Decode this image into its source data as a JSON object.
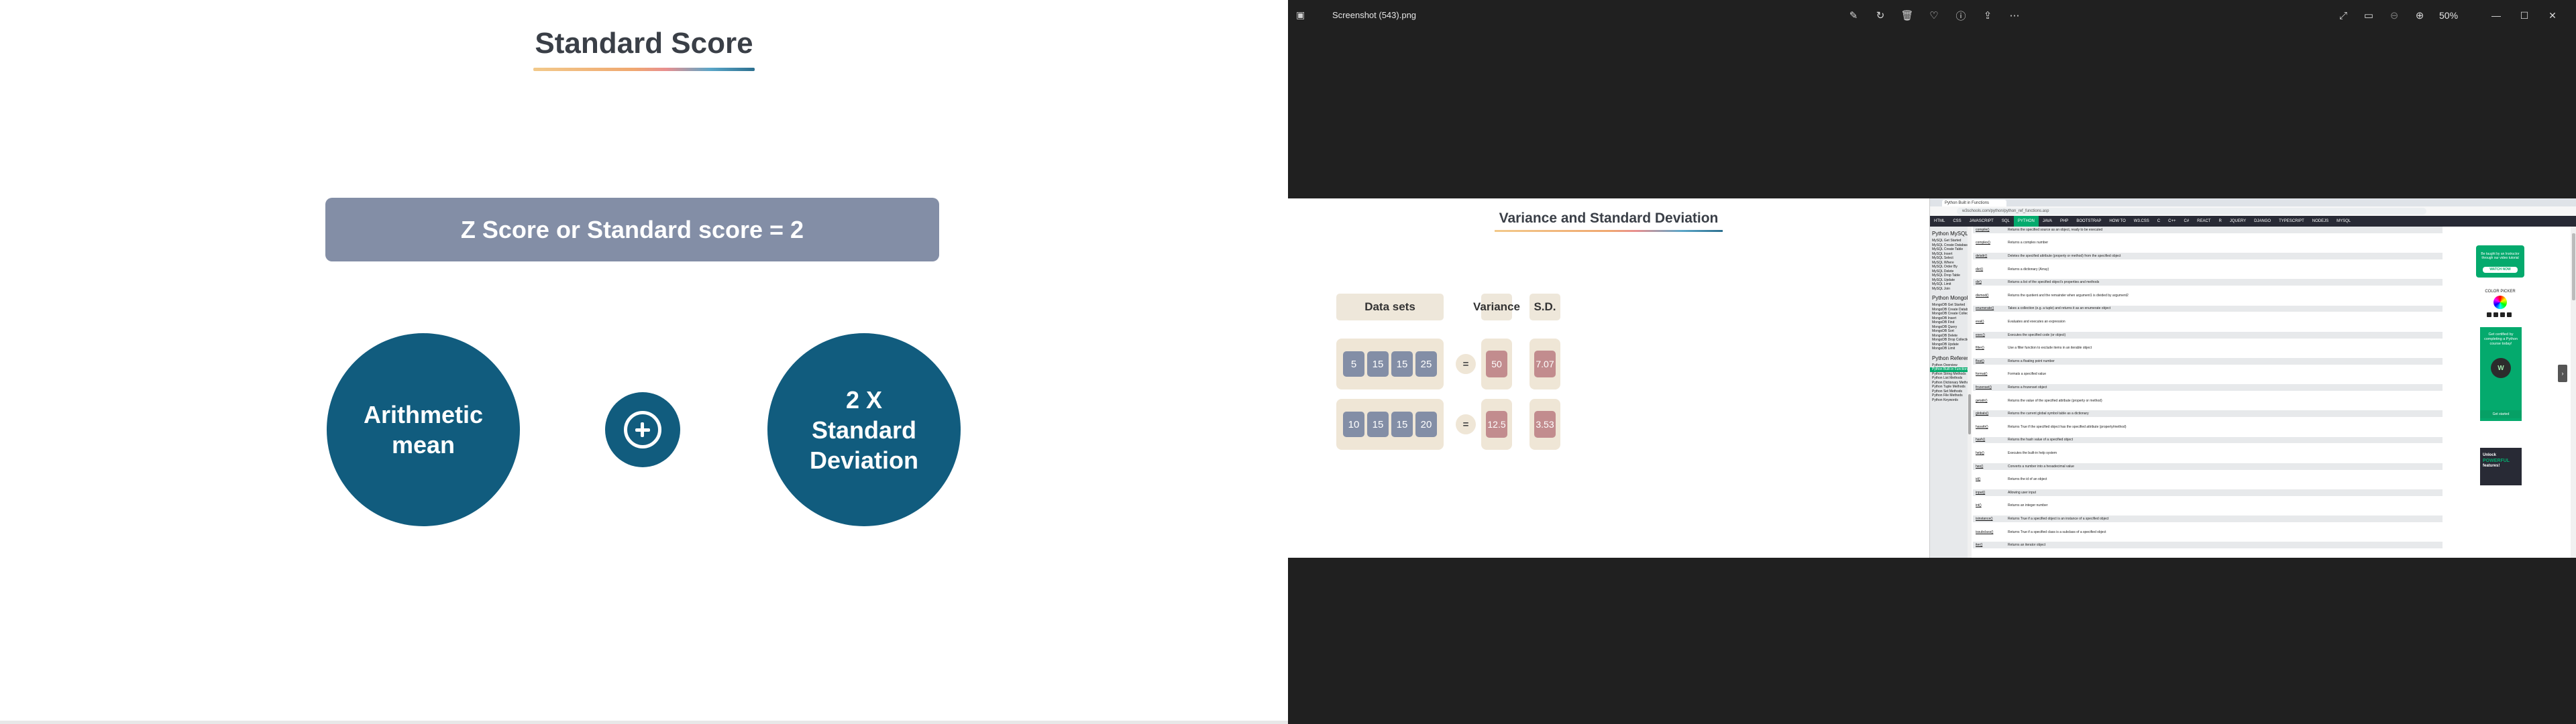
{
  "slide": {
    "title": "Standard Score",
    "z_bar": "Z Score or Standard score = 2",
    "circle_left": "Arithmetic mean",
    "circle_right": "2 X Standard Deviation"
  },
  "viewer": {
    "file_title": "Screenshot (543).png",
    "zoom": "50%",
    "toolbar_icons": [
      "edit-icon",
      "rotate-icon",
      "delete-icon",
      "favorite-icon",
      "info-icon",
      "share-icon",
      "more-icon"
    ],
    "window_icons": [
      "expand-icon",
      "fit-icon",
      "zoom-out-icon",
      "zoom-in-icon",
      "minimize-icon",
      "maximize-icon",
      "close-icon"
    ]
  },
  "inner_slide": {
    "title": "Variance and Standard Deviation",
    "headers": {
      "datasets": "Data sets",
      "variance": "Variance",
      "sd": "S.D."
    },
    "rows": [
      {
        "values": [
          "5",
          "15",
          "15",
          "25"
        ],
        "eq": "=",
        "variance": "50",
        "sd": "7.07"
      },
      {
        "values": [
          "10",
          "15",
          "15",
          "20"
        ],
        "eq": "=",
        "variance": "12.5",
        "sd": "3.53"
      }
    ]
  },
  "browser": {
    "tab_label": "Python Built in Functions",
    "url": "w3schools.com/python/python_ref_functions.asp",
    "nav": [
      "HTML",
      "CSS",
      "JAVASCRIPT",
      "SQL",
      "PYTHON",
      "JAVA",
      "PHP",
      "BOOTSTRAP",
      "HOW TO",
      "W3.CSS",
      "C",
      "C++",
      "C#",
      "REACT",
      "R",
      "JQUERY",
      "DJANGO",
      "TYPESCRIPT",
      "NODEJS",
      "MYSQL"
    ],
    "nav_active": "PYTHON",
    "sidebar": [
      {
        "t": "Python MySQL",
        "h": true
      },
      {
        "t": "MySQL Get Started"
      },
      {
        "t": "MySQL Create Database"
      },
      {
        "t": "MySQL Create Table"
      },
      {
        "t": "MySQL Insert"
      },
      {
        "t": "MySQL Select"
      },
      {
        "t": "MySQL Where"
      },
      {
        "t": "MySQL Order By"
      },
      {
        "t": "MySQL Delete"
      },
      {
        "t": "MySQL Drop Table"
      },
      {
        "t": "MySQL Update"
      },
      {
        "t": "MySQL Limit"
      },
      {
        "t": "MySQL Join"
      },
      {
        "t": "Python MongoDB",
        "h": true
      },
      {
        "t": "MongoDB Get Started"
      },
      {
        "t": "MongoDB Create Database"
      },
      {
        "t": "MongoDB Create Collection"
      },
      {
        "t": "MongoDB Insert"
      },
      {
        "t": "MongoDB Find"
      },
      {
        "t": "MongoDB Query"
      },
      {
        "t": "MongoDB Sort"
      },
      {
        "t": "MongoDB Delete"
      },
      {
        "t": "MongoDB Drop Collection"
      },
      {
        "t": "MongoDB Update"
      },
      {
        "t": "MongoDB Limit"
      },
      {
        "t": "Python Reference",
        "h": true
      },
      {
        "t": "Python Overview"
      },
      {
        "t": "Python Built-in Functions",
        "active": true
      },
      {
        "t": "Python String Methods"
      },
      {
        "t": "Python List Methods"
      },
      {
        "t": "Python Dictionary Methods"
      },
      {
        "t": "Python Tuple Methods"
      },
      {
        "t": "Python Set Methods"
      },
      {
        "t": "Python File Methods"
      },
      {
        "t": "Python Keywords"
      }
    ],
    "functions": [
      {
        "n": "compile()",
        "d": "Returns the specified source as an object, ready to be executed"
      },
      {
        "n": "complex()",
        "d": "Returns a complex number"
      },
      {
        "n": "delattr()",
        "d": "Deletes the specified attribute (property or method) from the specified object"
      },
      {
        "n": "dict()",
        "d": "Returns a dictionary (Array)"
      },
      {
        "n": "dir()",
        "d": "Returns a list of the specified object's properties and methods"
      },
      {
        "n": "divmod()",
        "d": "Returns the quotient and the remainder when argument1 is divided by argument2"
      },
      {
        "n": "enumerate()",
        "d": "Takes a collection (e.g. a tuple) and returns it as an enumerate object"
      },
      {
        "n": "eval()",
        "d": "Evaluates and executes an expression"
      },
      {
        "n": "exec()",
        "d": "Executes the specified code (or object)"
      },
      {
        "n": "filter()",
        "d": "Use a filter function to exclude items in an iterable object"
      },
      {
        "n": "float()",
        "d": "Returns a floating point number"
      },
      {
        "n": "format()",
        "d": "Formats a specified value"
      },
      {
        "n": "frozenset()",
        "d": "Returns a frozenset object"
      },
      {
        "n": "getattr()",
        "d": "Returns the value of the specified attribute (property or method)"
      },
      {
        "n": "globals()",
        "d": "Returns the current global symbol table as a dictionary"
      },
      {
        "n": "hasattr()",
        "d": "Returns True if the specified object has the specified attribute (property/method)"
      },
      {
        "n": "hash()",
        "d": "Returns the hash value of a specified object"
      },
      {
        "n": "help()",
        "d": "Executes the built-in help system"
      },
      {
        "n": "hex()",
        "d": "Converts a number into a hexadecimal value"
      },
      {
        "n": "id()",
        "d": "Returns the id of an object"
      },
      {
        "n": "input()",
        "d": "Allowing user input"
      },
      {
        "n": "int()",
        "d": "Returns an integer number"
      },
      {
        "n": "isinstance()",
        "d": "Returns True if a specified object is an instance of a specified object"
      },
      {
        "n": "issubclass()",
        "d": "Returns True if a specified class is a subclass of a specified object"
      },
      {
        "n": "iter()",
        "d": "Returns an iterator object"
      }
    ],
    "ads": {
      "ad1_text": "Be taught by an Instructor through our video tutorial",
      "ad1_button": "WATCH NOW",
      "color_picker": "COLOR PICKER",
      "ad2_text": "Get certified by completing a Python course today!",
      "ad2_button": "Get started",
      "ad3_line1": "Unlock",
      "ad3_line2": "POWERFUL",
      "ad3_line3": "features!"
    }
  }
}
